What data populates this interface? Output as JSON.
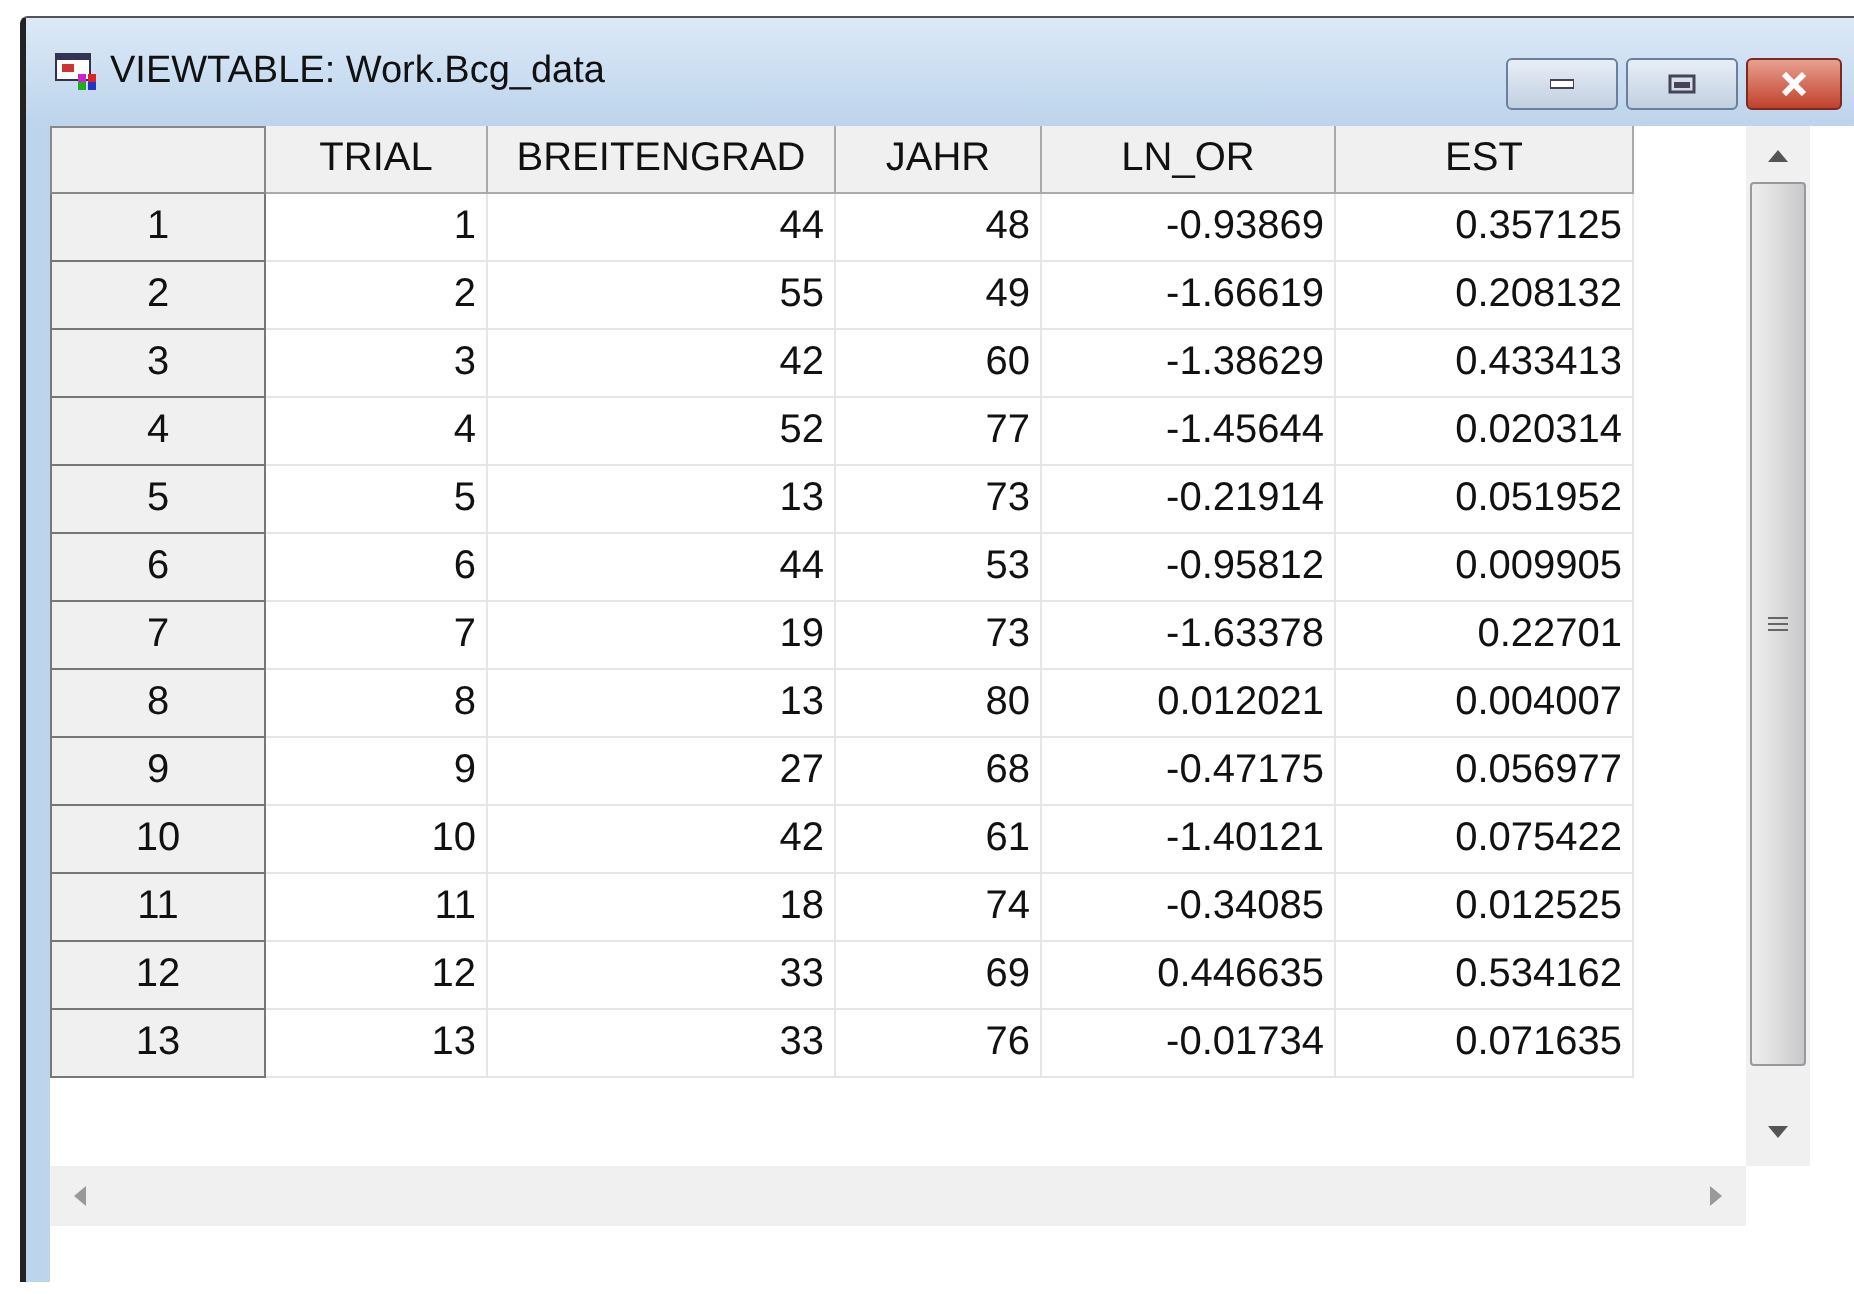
{
  "window": {
    "title": "VIEWTABLE: Work.Bcg_data"
  },
  "table": {
    "columns": [
      "TRIAL",
      "BREITENGRAD",
      "JAHR",
      "LN_OR",
      "EST"
    ],
    "rows": [
      {
        "label": "1",
        "cells": [
          "1",
          "44",
          "48",
          "-0.93869",
          "0.357125"
        ]
      },
      {
        "label": "2",
        "cells": [
          "2",
          "55",
          "49",
          "-1.66619",
          "0.208132"
        ]
      },
      {
        "label": "3",
        "cells": [
          "3",
          "42",
          "60",
          "-1.38629",
          "0.433413"
        ]
      },
      {
        "label": "4",
        "cells": [
          "4",
          "52",
          "77",
          "-1.45644",
          "0.020314"
        ]
      },
      {
        "label": "5",
        "cells": [
          "5",
          "13",
          "73",
          "-0.21914",
          "0.051952"
        ]
      },
      {
        "label": "6",
        "cells": [
          "6",
          "44",
          "53",
          "-0.95812",
          "0.009905"
        ]
      },
      {
        "label": "7",
        "cells": [
          "7",
          "19",
          "73",
          "-1.63378",
          "0.22701"
        ]
      },
      {
        "label": "8",
        "cells": [
          "8",
          "13",
          "80",
          "0.012021",
          "0.004007"
        ]
      },
      {
        "label": "9",
        "cells": [
          "9",
          "27",
          "68",
          "-0.47175",
          "0.056977"
        ]
      },
      {
        "label": "10",
        "cells": [
          "10",
          "42",
          "61",
          "-1.40121",
          "0.075422"
        ]
      },
      {
        "label": "11",
        "cells": [
          "11",
          "18",
          "74",
          "-0.34085",
          "0.012525"
        ]
      },
      {
        "label": "12",
        "cells": [
          "12",
          "33",
          "69",
          "0.446635",
          "0.534162"
        ]
      },
      {
        "label": "13",
        "cells": [
          "13",
          "33",
          "76",
          "-0.01734",
          "0.071635"
        ]
      }
    ]
  }
}
